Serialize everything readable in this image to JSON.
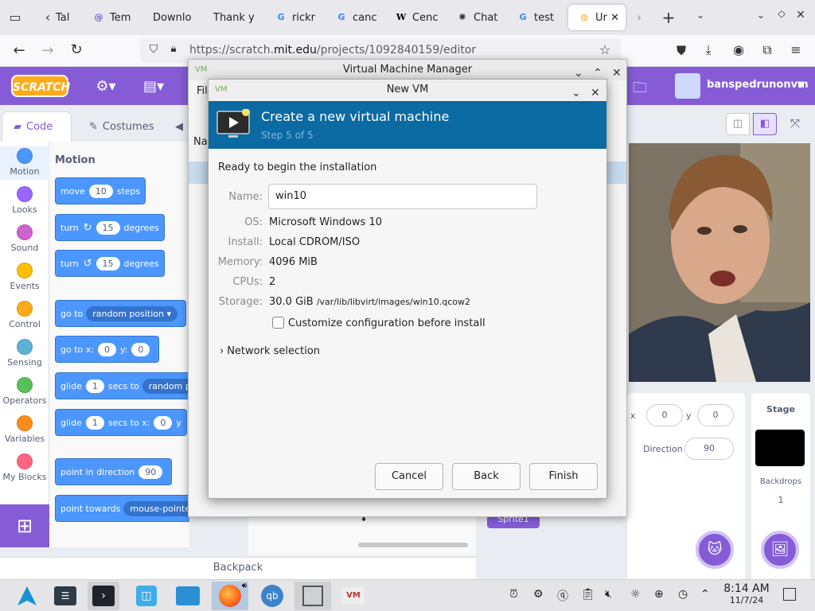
{
  "browser": {
    "tabs": [
      {
        "label": "Tal",
        "favicon": "firefox-view-icon"
      },
      {
        "label": "Tem",
        "favicon": "at-icon"
      },
      {
        "label": "Downlo",
        "favicon": "none"
      },
      {
        "label": "Thank y",
        "favicon": "none"
      },
      {
        "label": "rickr",
        "favicon": "google-icon"
      },
      {
        "label": "canc",
        "favicon": "google-icon"
      },
      {
        "label": "Cenc",
        "favicon": "wikipedia-icon"
      },
      {
        "label": "Chat",
        "favicon": "openai-icon"
      },
      {
        "label": "test",
        "favicon": "google-icon"
      },
      {
        "label": "Ur",
        "favicon": "scratch-icon"
      }
    ],
    "url_prefix": "https://scratch.",
    "url_domain": "mit.edu",
    "url_suffix": "/projects/1092840159/editor"
  },
  "scratch": {
    "logo": "SCRATCH",
    "menu_partial": "File",
    "username": "banspedrunonvm",
    "tabs": {
      "code": "Code",
      "costumes": "Costumes"
    },
    "categories": [
      {
        "label": "Motion",
        "color": "#4c97ff"
      },
      {
        "label": "Looks",
        "color": "#9966ff"
      },
      {
        "label": "Sound",
        "color": "#cf63cf"
      },
      {
        "label": "Events",
        "color": "#ffbf00"
      },
      {
        "label": "Control",
        "color": "#ffab19"
      },
      {
        "label": "Sensing",
        "color": "#5cb1d6"
      },
      {
        "label": "Operators",
        "color": "#59c059"
      },
      {
        "label": "Variables",
        "color": "#ff8c1a"
      },
      {
        "label": "My Blocks",
        "color": "#ff6680"
      }
    ],
    "palette_title": "Motion",
    "blocks": {
      "move": {
        "pre": "move",
        "val": "10",
        "post": "steps"
      },
      "turn_right": {
        "pre": "turn",
        "val": "15",
        "post": "degrees"
      },
      "turn_left": {
        "pre": "turn",
        "val": "15",
        "post": "degrees"
      },
      "goto": {
        "pre": "go to",
        "drop": "random position ▾"
      },
      "gotoxy": {
        "pre": "go to x:",
        "x": "0",
        "ylabel": "y:",
        "y": "0"
      },
      "glide1": {
        "pre": "glide",
        "val": "1",
        "mid": "secs to",
        "drop": "random p"
      },
      "glide2": {
        "pre": "glide",
        "val": "1",
        "mid": "secs to x:",
        "x": "0",
        "ylabel": "y"
      },
      "point_dir": {
        "pre": "point in direction",
        "val": "90"
      },
      "point_towards": {
        "pre": "point towards",
        "drop": "mouse-pointer"
      }
    },
    "backpack": "Backpack",
    "sprite_info": {
      "x_label": "x",
      "x": "0",
      "y_label": "y",
      "y": "0",
      "direction_label": "Direction",
      "direction": "90",
      "sprite_chip": "Sprite1"
    },
    "stage_pane": {
      "title": "Stage",
      "backdrops_label": "Backdrops",
      "backdrops_count": "1"
    },
    "workspace_partial": "Na"
  },
  "vmm": {
    "title": "Virtual Machine Manager",
    "menu_partial": "File"
  },
  "newvm": {
    "title": "New VM",
    "header": "Create a new virtual machine",
    "step": "Step 5 of 5",
    "ready": "Ready to begin the installation",
    "name_label": "Name:",
    "name_value": "win10",
    "os_label": "OS:",
    "os_value": "Microsoft Windows 10",
    "install_label": "Install:",
    "install_value": "Local CDROM/ISO",
    "memory_label": "Memory:",
    "memory_value": "4096 MiB",
    "cpus_label": "CPUs:",
    "cpus_value": "2",
    "storage_label": "Storage:",
    "storage_value": "30.0 GiB",
    "storage_path": "/var/lib/libvirt/images/win10.qcow2",
    "customize_label": "Customize configuration before install",
    "customize_checked": false,
    "network_label": "Network selection",
    "cancel": "Cancel",
    "back": "Back",
    "finish": "Finish"
  },
  "taskbar": {
    "time": "8:14 AM",
    "date": "11/7/24"
  }
}
